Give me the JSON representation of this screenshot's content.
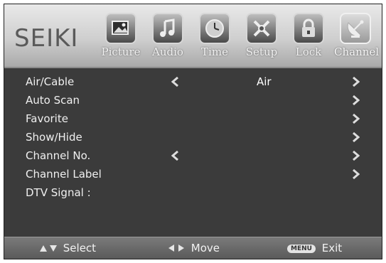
{
  "brand": "SEIKI",
  "tabs": [
    {
      "label": "Picture",
      "icon": "picture-icon"
    },
    {
      "label": "Audio",
      "icon": "audio-icon"
    },
    {
      "label": "Time",
      "icon": "clock-icon"
    },
    {
      "label": "Setup",
      "icon": "setup-icon"
    },
    {
      "label": "Lock",
      "icon": "lock-icon"
    },
    {
      "label": "Channel",
      "icon": "satellite-dish-icon",
      "active": true
    }
  ],
  "menu": {
    "items": [
      {
        "label": "Air/Cable",
        "value": "Air"
      },
      {
        "label": "Auto Scan"
      },
      {
        "label": "Favorite"
      },
      {
        "label": "Show/Hide"
      },
      {
        "label": "Channel No."
      },
      {
        "label": "Channel Label"
      },
      {
        "label": "DTV Signal :"
      }
    ]
  },
  "footer": {
    "select_label": "Select",
    "move_label": "Move",
    "menu_badge": "MENU",
    "exit_label": "Exit"
  }
}
